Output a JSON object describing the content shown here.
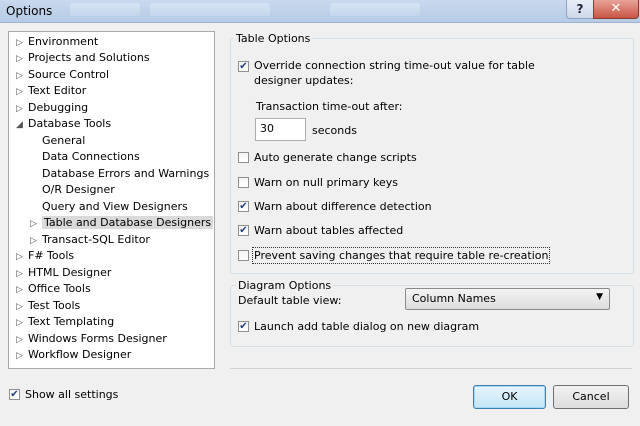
{
  "window": {
    "title": "Options",
    "help_label": "?",
    "close_label": "✕"
  },
  "tree": [
    {
      "label": "Environment",
      "arrow": "▷"
    },
    {
      "label": "Projects and Solutions",
      "arrow": "▷"
    },
    {
      "label": "Source Control",
      "arrow": "▷"
    },
    {
      "label": "Text Editor",
      "arrow": "▷"
    },
    {
      "label": "Debugging",
      "arrow": "▷"
    },
    {
      "label": "Database Tools",
      "arrow": "◢"
    },
    {
      "label": "General",
      "arrow": ""
    },
    {
      "label": "Data Connections",
      "arrow": ""
    },
    {
      "label": "Database Errors and Warnings",
      "arrow": ""
    },
    {
      "label": "O/R Designer",
      "arrow": ""
    },
    {
      "label": "Query and View Designers",
      "arrow": ""
    },
    {
      "label": "Table and Database Designers",
      "arrow": "▷"
    },
    {
      "label": "Transact-SQL Editor",
      "arrow": "▷"
    },
    {
      "label": "F# Tools",
      "arrow": "▷"
    },
    {
      "label": "HTML Designer",
      "arrow": "▷"
    },
    {
      "label": "Office Tools",
      "arrow": "▷"
    },
    {
      "label": "Test Tools",
      "arrow": "▷"
    },
    {
      "label": "Text Templating",
      "arrow": "▷"
    },
    {
      "label": "Windows Forms Designer",
      "arrow": "▷"
    },
    {
      "label": "Workflow Designer",
      "arrow": "▷"
    }
  ],
  "table_options": {
    "header": "Table Options",
    "override_label_1": "Override connection string time-out value for table",
    "override_label_2": "designer updates:",
    "timeout_label": "Transaction time-out after:",
    "timeout_value": "30",
    "seconds_label": "seconds",
    "auto_generate_label": "Auto generate change scripts",
    "warn_null_label": "Warn on null primary keys",
    "warn_difference_label": "Warn about difference detection",
    "warn_tables_label": "Warn about tables affected",
    "prevent_saving_label": "Prevent saving changes that require table re-creation",
    "checks": {
      "override": "✔",
      "auto_generate": "",
      "warn_null": "",
      "warn_difference": "✔",
      "warn_tables": "✔",
      "prevent_saving": ""
    }
  },
  "diagram_options": {
    "header": "Diagram Options",
    "default_view_label": "Default table view:",
    "default_view_value": "Column Names",
    "launch_label": "Launch add table dialog on new diagram",
    "launch_check": "✔"
  },
  "footer": {
    "show_all_label": "Show all settings",
    "show_all_check": "✔",
    "ok_label": "OK",
    "cancel_label": "Cancel"
  }
}
